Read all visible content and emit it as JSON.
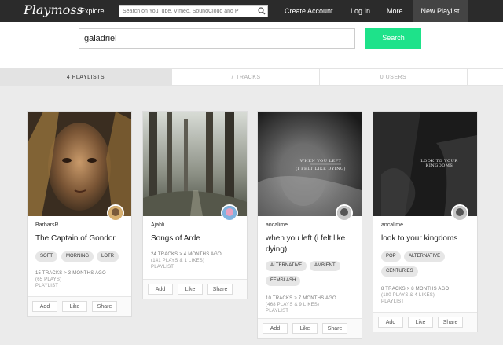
{
  "nav": {
    "logo": "Playmoss",
    "explore": "Explore",
    "search_placeholder": "Search on YouTube, Vimeo, SoundCloud and P",
    "create_account": "Create Account",
    "login": "Log In",
    "more": "More",
    "new_playlist": "New Playlist"
  },
  "search": {
    "query": "galadriel",
    "button": "Search"
  },
  "tabs": [
    {
      "label": "4 PLAYLISTS",
      "active": true
    },
    {
      "label": "7 TRACKS",
      "active": false
    },
    {
      "label": "0 USERS",
      "active": false
    }
  ],
  "cards": [
    {
      "author": "BarbarsR",
      "title": "The Captain of Gondor",
      "tags": [
        "SOFT",
        "MORNING",
        "LOTR"
      ],
      "meta1": "15 TRACKS > 3 MONTHS AGO",
      "meta2": "(65 PLAYS)",
      "meta3": "PLAYLIST",
      "actions": [
        "Add",
        "Like",
        "Share"
      ]
    },
    {
      "author": "Ajahli",
      "title": "Songs of Arde",
      "tags": [],
      "meta1": "24 TRACKS > 4 MONTHS AGO",
      "meta2": "(141 PLAYS & 1 LIKES)",
      "meta3": "PLAYLIST",
      "actions": [
        "Add",
        "Like",
        "Share"
      ]
    },
    {
      "author": "ancalime",
      "title": "when you left (i felt like dying)",
      "tags": [
        "ALTERNATIVE",
        "AMBIENT",
        "FEMSLASH"
      ],
      "meta1": "10 TRACKS > 7 MONTHS AGO",
      "meta2": "(468 PLAYS & 9 LIKES)",
      "meta3": "PLAYLIST",
      "cover_text": [
        "WHEN YOU LEFT",
        "(I FELT LIKE DYING)"
      ],
      "actions": [
        "Add",
        "Like",
        "Share"
      ]
    },
    {
      "author": "ancalime",
      "title": "look to your kingdoms",
      "tags": [
        "POP",
        "ALTERNATIVE",
        "CENTURIES"
      ],
      "meta1": "8 TRACKS > 8 MONTHS AGO",
      "meta2": "(180 PLAYS & 4 LIKES)",
      "meta3": "PLAYLIST",
      "cover_text": [
        "LOOK TO YOUR KINGDOMS"
      ],
      "actions": [
        "Add",
        "Like",
        "Share"
      ]
    }
  ],
  "colors": {
    "nav_bg": "#2b2b2b",
    "accent": "#1ee28a",
    "page_bg": "#ebebeb"
  }
}
